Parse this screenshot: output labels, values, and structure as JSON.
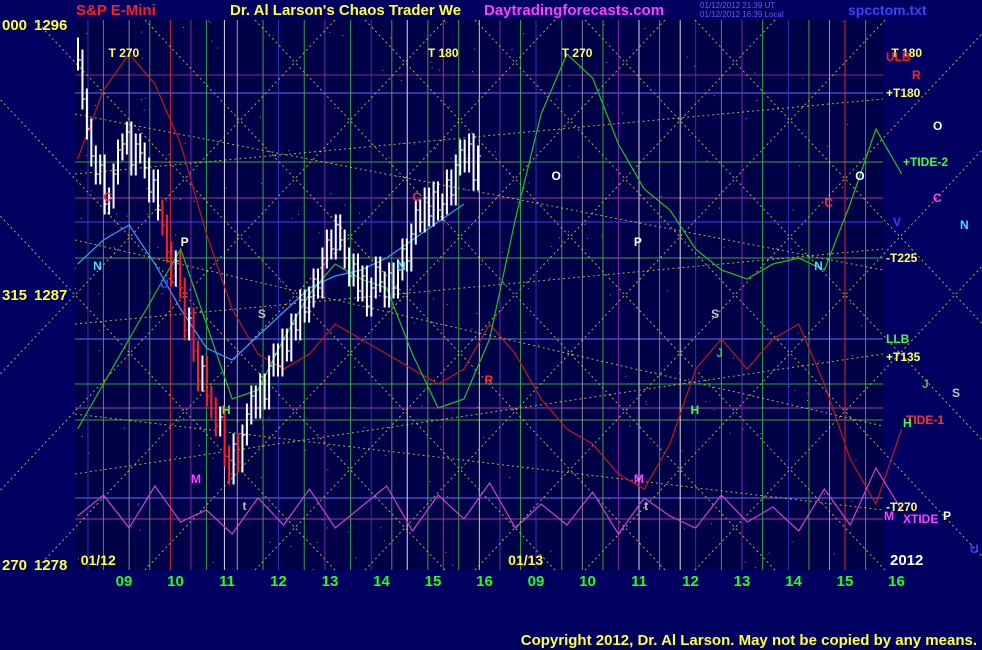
{
  "header": {
    "symbol": "S&P E-Mini",
    "title": "Dr. Al Larson's Chaos Trader We",
    "site": "Daytradingforecasts.com",
    "date_line1": "01/12/2012 21:39 UT",
    "date_line2": "01/12/2012 16:39 Local",
    "filename": "spcctom.txt"
  },
  "footer": {
    "copyright": "Copyright 2012, Dr. Al Larson. May not be copied by any means."
  },
  "colors": {
    "background": "#000060",
    "grid_purple": "#5a2a9a",
    "price_bar": "#ffffff",
    "down_bar": "#ff2020",
    "tide_green": "#20c020",
    "tide_red": "#c01818",
    "xtide_magenta": "#d040d0",
    "trend_yellow": "#e0e040",
    "time_label": "#20ff20",
    "left_axis": "#ffff40"
  },
  "chart_data": {
    "type": "line",
    "title": "S&P E-Mini",
    "ylim": [
      1278,
      1296
    ],
    "y_tick_labels": [
      {
        "angle": "000",
        "price": "1296",
        "value": 1296
      },
      {
        "angle": "315",
        "price": "1287",
        "value": 1287
      },
      {
        "angle": "270",
        "price": "1278",
        "value": 1278
      }
    ],
    "x_tick_labels": [
      "09",
      "10",
      "11",
      "12",
      "13",
      "14",
      "15",
      "16",
      "09",
      "10",
      "11",
      "12",
      "13",
      "14",
      "15",
      "16"
    ],
    "date_labels": [
      {
        "text": "01/12",
        "at_hour": 0.2
      },
      {
        "text": "01/13",
        "at_hour": 8.5
      }
    ],
    "year_label": "2012",
    "right_labels": [
      {
        "text": "ULB",
        "color": "#ff2020",
        "value": 1294.9
      },
      {
        "text": "R",
        "color": "#ff2020",
        "value": 1294.3
      },
      {
        "text": "+T180",
        "color": "#ffff60",
        "value": 1293.7
      },
      {
        "text": "O",
        "color": "#ffffff",
        "value": 1292.6
      },
      {
        "text": "+TIDE-2",
        "color": "#40ff40",
        "value": 1291.4
      },
      {
        "text": "C",
        "color": "#ff40ff",
        "value": 1290.2
      },
      {
        "text": "V",
        "color": "#4040ff",
        "value": 1289.4
      },
      {
        "text": "N",
        "color": "#40e0ff",
        "value": 1289.3
      },
      {
        "text": "-T225",
        "color": "#ffff60",
        "value": 1288.2
      },
      {
        "text": "LLB",
        "color": "#40ff40",
        "value": 1285.5
      },
      {
        "text": "+T135",
        "color": "#ffff60",
        "value": 1284.9
      },
      {
        "text": "J",
        "color": "#40c040",
        "value": 1284.0
      },
      {
        "text": "S",
        "color": "#c0c0c0",
        "value": 1283.7
      },
      {
        "text": "TIDE-1",
        "color": "#ff3030",
        "value": 1282.8
      },
      {
        "text": "H",
        "color": "#40ff40",
        "value": 1282.7
      },
      {
        "text": "-T270",
        "color": "#ffff60",
        "value": 1279.9
      },
      {
        "text": "M",
        "color": "#ff40ff",
        "value": 1279.6
      },
      {
        "text": "XTIDE",
        "color": "#ff40ff",
        "value": 1279.5
      },
      {
        "text": "P",
        "color": "#ffffff",
        "value": 1279.6
      },
      {
        "text": "U",
        "color": "#4040ff",
        "value": 1278.5
      }
    ],
    "vertical_tags": [
      {
        "text": "T 270",
        "at_hour": 0.6,
        "value": 1294.9,
        "color": "#ffff60"
      },
      {
        "text": "T 180",
        "at_hour": 6.8,
        "value": 1294.9,
        "color": "#ffff60"
      },
      {
        "text": "T 270",
        "at_hour": 9.4,
        "value": 1294.9,
        "color": "#ffff60"
      },
      {
        "text": "T 180",
        "at_hour": 15.8,
        "value": 1294.9,
        "color": "#ffff60"
      }
    ],
    "event_labels": [
      {
        "text": "C",
        "hour": 0.5,
        "value": 1290.1,
        "color": "#ff3030"
      },
      {
        "text": "N",
        "hour": 0.3,
        "value": 1287.8,
        "color": "#40e0ff"
      },
      {
        "text": "P",
        "hour": 2.0,
        "value": 1288.6,
        "color": "#ffffff"
      },
      {
        "text": "U",
        "hour": 1.6,
        "value": 1287.2,
        "color": "#4040ff"
      },
      {
        "text": "H",
        "hour": 2.8,
        "value": 1283.0,
        "color": "#40ff40"
      },
      {
        "text": "M",
        "hour": 2.2,
        "value": 1280.7,
        "color": "#ff40ff"
      },
      {
        "text": "S",
        "hour": 3.5,
        "value": 1286.2,
        "color": "#c0c0c0"
      },
      {
        "text": "t",
        "hour": 3.2,
        "value": 1279.8,
        "color": "#c0c0c0"
      },
      {
        "text": "C",
        "hour": 6.5,
        "value": 1290.1,
        "color": "#ff3030"
      },
      {
        "text": "N",
        "hour": 6.2,
        "value": 1287.8,
        "color": "#40e0ff"
      },
      {
        "text": "R",
        "hour": 7.9,
        "value": 1284.0,
        "color": "#ff3030"
      },
      {
        "text": "O",
        "hour": 9.2,
        "value": 1290.8,
        "color": "#ffffff"
      },
      {
        "text": "P",
        "hour": 10.8,
        "value": 1288.6,
        "color": "#ffffff"
      },
      {
        "text": "M",
        "hour": 10.8,
        "value": 1280.7,
        "color": "#ff40ff"
      },
      {
        "text": "t",
        "hour": 11.0,
        "value": 1279.8,
        "color": "#c0c0c0"
      },
      {
        "text": "S",
        "hour": 12.3,
        "value": 1286.2,
        "color": "#c0c0c0"
      },
      {
        "text": "J",
        "hour": 12.4,
        "value": 1284.9,
        "color": "#40c040"
      },
      {
        "text": "H",
        "hour": 11.9,
        "value": 1283.0,
        "color": "#40ff40"
      },
      {
        "text": "N",
        "hour": 14.3,
        "value": 1287.8,
        "color": "#40e0ff"
      },
      {
        "text": "C",
        "hour": 14.5,
        "value": 1289.9,
        "color": "#ff3030"
      },
      {
        "text": "O",
        "hour": 15.1,
        "value": 1290.8,
        "color": "#ffffff"
      }
    ],
    "series": [
      {
        "name": "price",
        "kind": "bars",
        "values": [
          1294.8,
          1293.5,
          1292.5,
          1291.6,
          1291.0,
          1291.3,
          1290.0,
          1290.2,
          1291.0,
          1291.8,
          1292.0,
          1292.4,
          1291.3,
          1292.0,
          1291.7,
          1291.2,
          1290.4,
          1290.8,
          1289.8,
          1289.3,
          1288.4,
          1287.6,
          1288.1,
          1287.2,
          1285.8,
          1286.2,
          1285.1,
          1284.1,
          1284.6,
          1283.6,
          1283.2,
          1282.6,
          1282.9,
          1281.6,
          1281.0,
          1282.0,
          1281.4,
          1282.3,
          1283.0,
          1283.6,
          1283.2,
          1284.0,
          1283.5,
          1284.6,
          1285.0,
          1284.6,
          1285.5,
          1285.1,
          1286.0,
          1285.8,
          1286.8,
          1286.4,
          1286.9,
          1287.5,
          1287.2,
          1288.2,
          1288.8,
          1288.5,
          1289.3,
          1288.8,
          1288.2,
          1287.6,
          1288.0,
          1287.1,
          1287.6,
          1286.6,
          1287.2,
          1287.9,
          1287.4,
          1286.9,
          1287.7,
          1287.2,
          1287.8,
          1288.5,
          1288.1,
          1289.0,
          1289.8,
          1289.4,
          1290.2,
          1289.6,
          1290.4,
          1289.8,
          1290.0,
          1290.8,
          1290.3,
          1291.3,
          1291.8,
          1291.4,
          1292.0,
          1290.8,
          1291.6
        ]
      },
      {
        "name": "TIDE-1",
        "kind": "line",
        "color": "#c01818",
        "x": [
          0,
          0.5,
          1,
          1.5,
          2,
          2.5,
          3,
          3.5,
          4,
          4.5,
          5,
          5.5,
          6,
          6.5,
          7,
          7.5,
          8,
          8.5,
          9,
          9.5,
          10,
          10.5,
          11,
          11.5,
          12,
          12.5,
          13,
          13.5,
          14,
          14.5,
          15,
          15.5,
          16
        ],
        "values": [
          1291.5,
          1293.8,
          1295.0,
          1294.0,
          1292.0,
          1289.0,
          1286.5,
          1285.0,
          1284.5,
          1285.0,
          1286.0,
          1285.5,
          1285.0,
          1284.5,
          1284.0,
          1284.5,
          1286.0,
          1285.0,
          1283.5,
          1282.5,
          1282.0,
          1281.0,
          1280.5,
          1282.0,
          1284.5,
          1285.5,
          1284.5,
          1285.5,
          1286.0,
          1284.0,
          1281.5,
          1280.0,
          1282.5
        ]
      },
      {
        "name": "TIDE-2",
        "kind": "line",
        "color": "#20c020",
        "x": [
          0,
          0.5,
          1,
          1.5,
          2,
          2.5,
          3,
          3.5,
          4,
          4.5,
          5,
          5.5,
          6,
          6.5,
          7,
          7.5,
          8,
          8.5,
          9,
          9.5,
          10,
          10.5,
          11,
          11.5,
          12,
          12.5,
          13,
          13.5,
          14,
          14.5,
          15,
          15.5,
          16
        ],
        "values": [
          1282.5,
          1284.0,
          1285.5,
          1287.0,
          1288.5,
          1286.0,
          1283.5,
          1283.8,
          1285.5,
          1287.0,
          1288.0,
          1287.5,
          1287.2,
          1285.0,
          1283.2,
          1283.5,
          1285.5,
          1289.5,
          1293.0,
          1295.0,
          1294.2,
          1292.0,
          1290.5,
          1289.8,
          1288.5,
          1287.8,
          1287.5,
          1288.0,
          1288.2,
          1287.8,
          1290.0,
          1292.5,
          1291.0
        ]
      },
      {
        "name": "XTIDE",
        "kind": "line",
        "color": "#d040d0",
        "x": [
          0,
          0.5,
          1,
          1.5,
          2,
          2.5,
          3,
          3.5,
          4,
          4.5,
          5,
          5.5,
          6,
          6.5,
          7,
          7.5,
          8,
          8.5,
          9,
          9.5,
          10,
          10.5,
          11,
          11.5,
          12,
          12.5,
          13,
          13.5,
          14,
          14.5,
          15,
          15.5,
          16
        ],
        "values": [
          1279.6,
          1280.3,
          1279.2,
          1280.6,
          1279.4,
          1279.8,
          1279.0,
          1280.2,
          1279.3,
          1280.5,
          1279.2,
          1279.9,
          1280.6,
          1279.1,
          1280.3,
          1279.5,
          1280.7,
          1279.2,
          1280.0,
          1279.3,
          1280.4,
          1279.0,
          1280.2,
          1279.6,
          1279.2,
          1280.3,
          1279.4,
          1279.9,
          1279.1,
          1280.5,
          1279.3,
          1281.2,
          1279.8
        ]
      },
      {
        "name": "",
        "kind": "line",
        "color": "#30a0ff",
        "x": [
          0,
          0.5,
          1,
          1.5,
          2,
          2.5,
          3,
          3.5,
          4,
          4.5,
          5,
          5.5,
          6,
          6.5,
          7,
          7.5
        ],
        "values": [
          1288.0,
          1288.8,
          1289.3,
          1288.0,
          1286.5,
          1285.2,
          1284.8,
          1285.6,
          1286.4,
          1287.2,
          1287.6,
          1287.8,
          1288.2,
          1288.8,
          1289.4,
          1290.0
        ]
      }
    ]
  }
}
